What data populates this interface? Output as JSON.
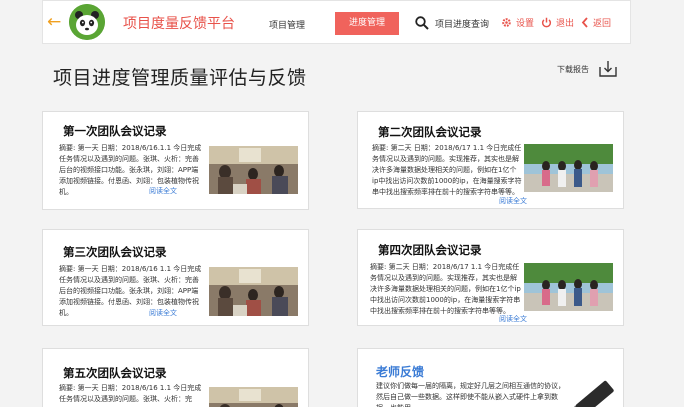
{
  "header": {
    "brand": "项目度量反馈平台",
    "nav_project": "项目管理",
    "nav_progress": "进度管理",
    "search_label": "项目进度查询",
    "settings_label": "设置",
    "logout_label": "退出",
    "back_label": "返回",
    "accent": "#e8524a"
  },
  "page": {
    "title": "项目进度管理质量评估与反馈",
    "download_label": "下载报告"
  },
  "cards": [
    {
      "title": "第一次团队会议记录",
      "text": "摘要: 第一天 日期：2018/6/16.1.1 今日完成任务情况以及遇到的问题。张琪、火析：完善后台的视频接口功能。张永琪，刘翊：APP端添加视频链接。付恩函、刘翊：包装植物传祝机。",
      "read_more": "阅读全文"
    },
    {
      "title": "第二次团队会议记录",
      "text": "摘要: 第二天 日期：2018/6/17 1.1 今日完成任务情况以及遇到的问题。实现推荐，其实也是解决许多海量数据处理相关的问题，例如在1亿个ip中找出访问次数前1000的ip，在海量搜索字符串中找出搜索频率排在前十的搜索字符串等等。",
      "read_more": "阅读全文"
    },
    {
      "title": "第三次团队会议记录",
      "text": "摘要: 第一天 日期：2018/6/16 1.1 今日完成任务情况以及遇到的问题。张琪、火析：完善后台的视频接口功能。张永琪，刘翊：APP端添加视频链接。付恩函、刘翊：包装植物传祝机。",
      "read_more": "阅读全文"
    },
    {
      "title": "第四次团队会议记录",
      "text": "摘要: 第二天 日期：2018/6/17 1.1 今日完成任务情况以及遇到的问题。实现推荐，其实也是解决许多海量数据处理相关的问题，例如在1亿个ip中找出访问次数前1000的ip，在海量搜索字符串中找出搜索频率排在前十的搜索字符串等等。",
      "read_more": "阅读全文"
    },
    {
      "title": "第五次团队会议记录",
      "text": "摘要: 第一天 日期：2018/6/16 1.1 今日完成任务情况以及遇到的问题。张琪、火析：完",
      "read_more": ""
    }
  ],
  "teacher": {
    "title": "老师反馈",
    "text": "建议你们做每一届的隔离，规定好几层之间相互通信的协议，然后自己做一些数据。这样即使不能从嵌入式硬件上拿到数据，也能用"
  }
}
